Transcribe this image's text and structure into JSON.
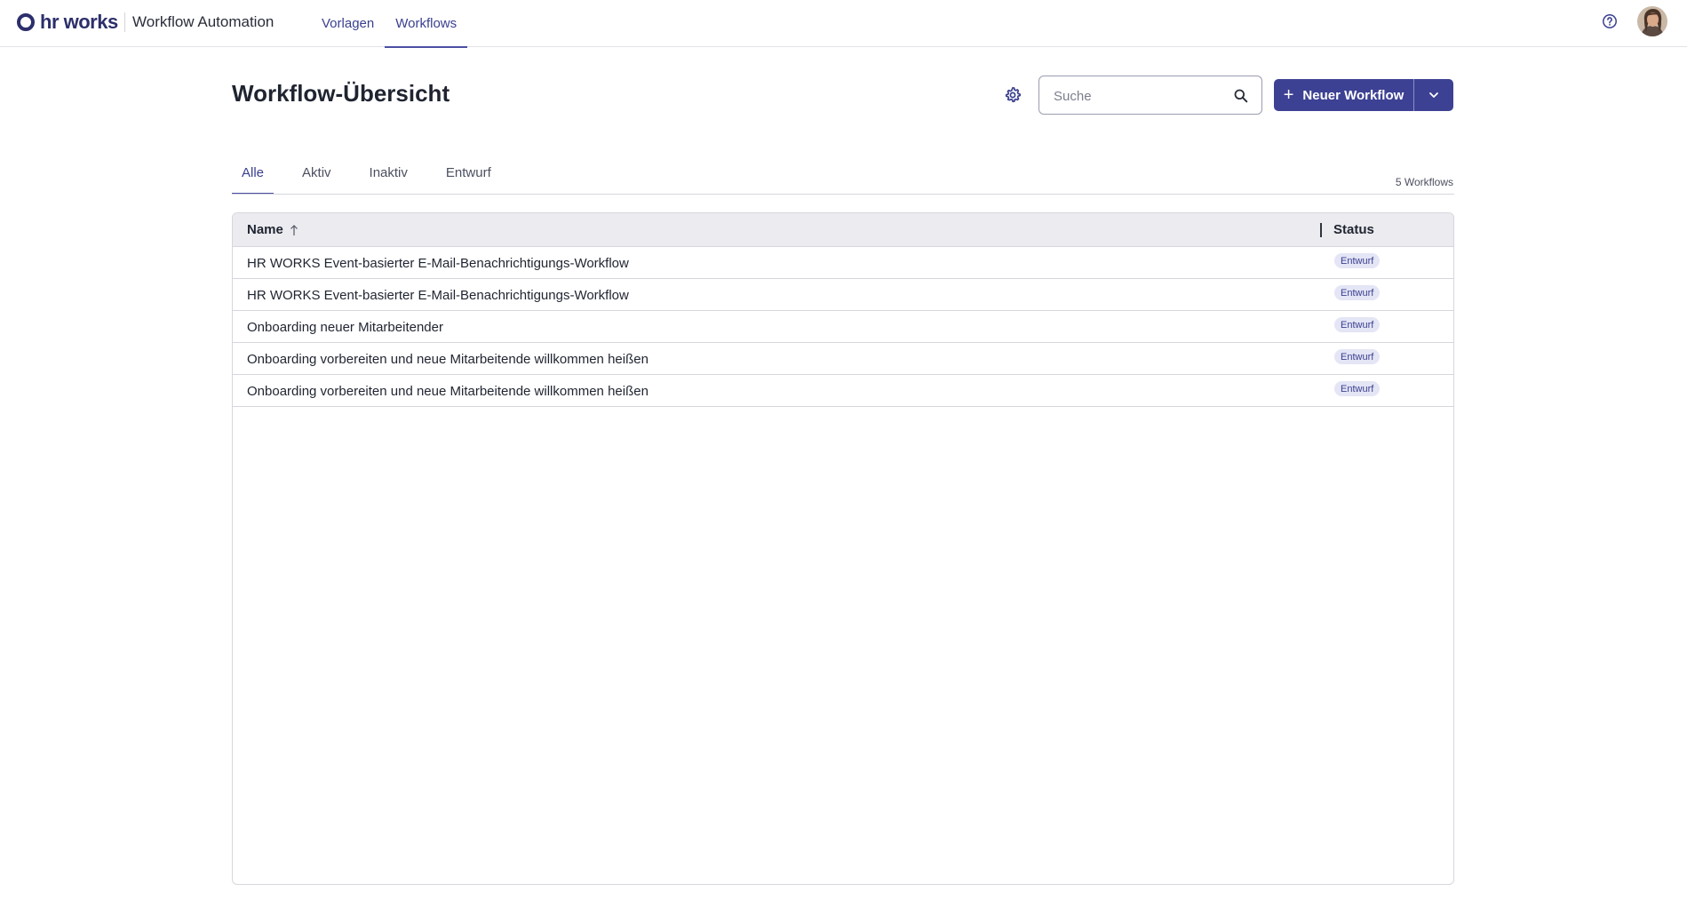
{
  "brand": {
    "logo_text": "hr works",
    "app_title": "Workflow Automation"
  },
  "nav": {
    "items": [
      {
        "label": "Vorlagen",
        "active": false
      },
      {
        "label": "Workflows",
        "active": true
      }
    ]
  },
  "header": {
    "title": "Workflow-Übersicht",
    "search": {
      "placeholder": "Suche",
      "value": ""
    },
    "new_button_label": "Neuer Workflow"
  },
  "tabs": [
    {
      "label": "Alle",
      "active": true
    },
    {
      "label": "Aktiv",
      "active": false
    },
    {
      "label": "Inaktiv",
      "active": false
    },
    {
      "label": "Entwurf",
      "active": false
    }
  ],
  "count_label": "5 Workflows",
  "table": {
    "columns": {
      "name": "Name",
      "status": "Status"
    },
    "rows": [
      {
        "name": "HR WORKS Event-basierter E-Mail-Benachrichtigungs-Workflow",
        "status": "Entwurf"
      },
      {
        "name": "HR WORKS Event-basierter E-Mail-Benachrichtigungs-Workflow",
        "status": "Entwurf"
      },
      {
        "name": "Onboarding neuer Mitarbeitender",
        "status": "Entwurf"
      },
      {
        "name": "Onboarding vorbereiten und neue Mitarbeitende willkommen heißen",
        "status": "Entwurf"
      },
      {
        "name": "Onboarding vorbereiten und neue Mitarbeitende willkommen heißen",
        "status": "Entwurf"
      }
    ]
  },
  "icons": {
    "help": "help-circle-icon",
    "settings": "gear-icon",
    "search": "search-icon",
    "sort": "arrow-up-icon",
    "dropdown": "chevron-down-icon",
    "plus": "plus-icon"
  },
  "colors": {
    "primary": "#3d4193",
    "nav_text": "#3a3f8f",
    "badge_bg": "#e4e5f5",
    "header_bg": "#ebebf0"
  }
}
